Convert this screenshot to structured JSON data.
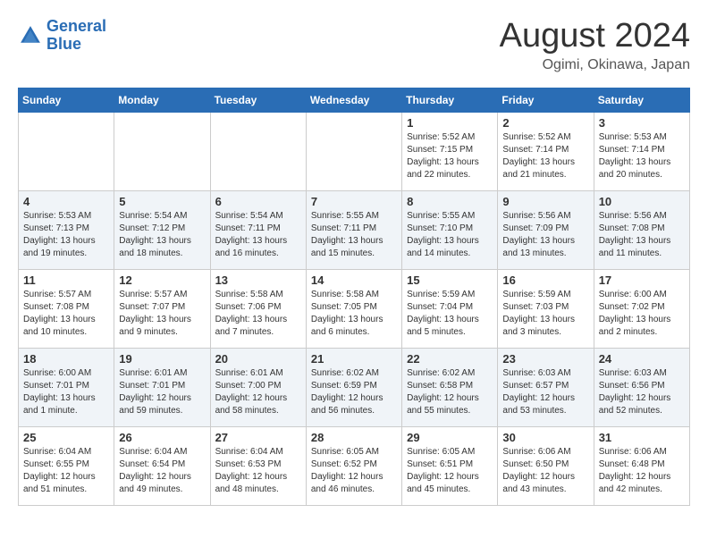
{
  "header": {
    "logo_line1": "General",
    "logo_line2": "Blue",
    "month_year": "August 2024",
    "location": "Ogimi, Okinawa, Japan"
  },
  "weekdays": [
    "Sunday",
    "Monday",
    "Tuesday",
    "Wednesday",
    "Thursday",
    "Friday",
    "Saturday"
  ],
  "weeks": [
    [
      {
        "day": "",
        "info": ""
      },
      {
        "day": "",
        "info": ""
      },
      {
        "day": "",
        "info": ""
      },
      {
        "day": "",
        "info": ""
      },
      {
        "day": "1",
        "info": "Sunrise: 5:52 AM\nSunset: 7:15 PM\nDaylight: 13 hours\nand 22 minutes."
      },
      {
        "day": "2",
        "info": "Sunrise: 5:52 AM\nSunset: 7:14 PM\nDaylight: 13 hours\nand 21 minutes."
      },
      {
        "day": "3",
        "info": "Sunrise: 5:53 AM\nSunset: 7:14 PM\nDaylight: 13 hours\nand 20 minutes."
      }
    ],
    [
      {
        "day": "4",
        "info": "Sunrise: 5:53 AM\nSunset: 7:13 PM\nDaylight: 13 hours\nand 19 minutes."
      },
      {
        "day": "5",
        "info": "Sunrise: 5:54 AM\nSunset: 7:12 PM\nDaylight: 13 hours\nand 18 minutes."
      },
      {
        "day": "6",
        "info": "Sunrise: 5:54 AM\nSunset: 7:11 PM\nDaylight: 13 hours\nand 16 minutes."
      },
      {
        "day": "7",
        "info": "Sunrise: 5:55 AM\nSunset: 7:11 PM\nDaylight: 13 hours\nand 15 minutes."
      },
      {
        "day": "8",
        "info": "Sunrise: 5:55 AM\nSunset: 7:10 PM\nDaylight: 13 hours\nand 14 minutes."
      },
      {
        "day": "9",
        "info": "Sunrise: 5:56 AM\nSunset: 7:09 PM\nDaylight: 13 hours\nand 13 minutes."
      },
      {
        "day": "10",
        "info": "Sunrise: 5:56 AM\nSunset: 7:08 PM\nDaylight: 13 hours\nand 11 minutes."
      }
    ],
    [
      {
        "day": "11",
        "info": "Sunrise: 5:57 AM\nSunset: 7:08 PM\nDaylight: 13 hours\nand 10 minutes."
      },
      {
        "day": "12",
        "info": "Sunrise: 5:57 AM\nSunset: 7:07 PM\nDaylight: 13 hours\nand 9 minutes."
      },
      {
        "day": "13",
        "info": "Sunrise: 5:58 AM\nSunset: 7:06 PM\nDaylight: 13 hours\nand 7 minutes."
      },
      {
        "day": "14",
        "info": "Sunrise: 5:58 AM\nSunset: 7:05 PM\nDaylight: 13 hours\nand 6 minutes."
      },
      {
        "day": "15",
        "info": "Sunrise: 5:59 AM\nSunset: 7:04 PM\nDaylight: 13 hours\nand 5 minutes."
      },
      {
        "day": "16",
        "info": "Sunrise: 5:59 AM\nSunset: 7:03 PM\nDaylight: 13 hours\nand 3 minutes."
      },
      {
        "day": "17",
        "info": "Sunrise: 6:00 AM\nSunset: 7:02 PM\nDaylight: 13 hours\nand 2 minutes."
      }
    ],
    [
      {
        "day": "18",
        "info": "Sunrise: 6:00 AM\nSunset: 7:01 PM\nDaylight: 13 hours\nand 1 minute."
      },
      {
        "day": "19",
        "info": "Sunrise: 6:01 AM\nSunset: 7:01 PM\nDaylight: 12 hours\nand 59 minutes."
      },
      {
        "day": "20",
        "info": "Sunrise: 6:01 AM\nSunset: 7:00 PM\nDaylight: 12 hours\nand 58 minutes."
      },
      {
        "day": "21",
        "info": "Sunrise: 6:02 AM\nSunset: 6:59 PM\nDaylight: 12 hours\nand 56 minutes."
      },
      {
        "day": "22",
        "info": "Sunrise: 6:02 AM\nSunset: 6:58 PM\nDaylight: 12 hours\nand 55 minutes."
      },
      {
        "day": "23",
        "info": "Sunrise: 6:03 AM\nSunset: 6:57 PM\nDaylight: 12 hours\nand 53 minutes."
      },
      {
        "day": "24",
        "info": "Sunrise: 6:03 AM\nSunset: 6:56 PM\nDaylight: 12 hours\nand 52 minutes."
      }
    ],
    [
      {
        "day": "25",
        "info": "Sunrise: 6:04 AM\nSunset: 6:55 PM\nDaylight: 12 hours\nand 51 minutes."
      },
      {
        "day": "26",
        "info": "Sunrise: 6:04 AM\nSunset: 6:54 PM\nDaylight: 12 hours\nand 49 minutes."
      },
      {
        "day": "27",
        "info": "Sunrise: 6:04 AM\nSunset: 6:53 PM\nDaylight: 12 hours\nand 48 minutes."
      },
      {
        "day": "28",
        "info": "Sunrise: 6:05 AM\nSunset: 6:52 PM\nDaylight: 12 hours\nand 46 minutes."
      },
      {
        "day": "29",
        "info": "Sunrise: 6:05 AM\nSunset: 6:51 PM\nDaylight: 12 hours\nand 45 minutes."
      },
      {
        "day": "30",
        "info": "Sunrise: 6:06 AM\nSunset: 6:50 PM\nDaylight: 12 hours\nand 43 minutes."
      },
      {
        "day": "31",
        "info": "Sunrise: 6:06 AM\nSunset: 6:48 PM\nDaylight: 12 hours\nand 42 minutes."
      }
    ]
  ]
}
